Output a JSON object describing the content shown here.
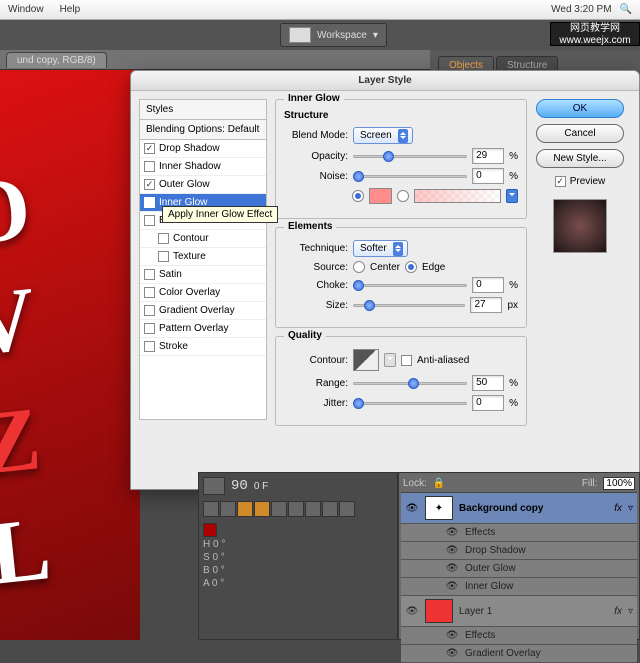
{
  "menubar": {
    "window": "Window",
    "help": "Help",
    "clock": "Wed 3:20 PM"
  },
  "watermark": {
    "line1": "网页教学网",
    "line2": "www.weejx.com"
  },
  "appbar": {
    "workspace_label": "Workspace",
    "caret": "▾"
  },
  "doc": {
    "tab": "und copy, RGB/8)"
  },
  "panel_tabs": {
    "objects": "Objects",
    "structure": "Structure"
  },
  "dialog": {
    "title": "Layer Style",
    "styles_header": "Styles",
    "blending": "Blending Options: Default",
    "items": [
      {
        "label": "Drop Shadow",
        "checked": true
      },
      {
        "label": "Inner Shadow",
        "checked": false
      },
      {
        "label": "Outer Glow",
        "checked": true
      },
      {
        "label": "Inner Glow",
        "checked": true,
        "selected": true
      },
      {
        "label": "Bevel and Emboss",
        "checked": false,
        "truncated": "Bev"
      },
      {
        "label": "Contour",
        "checked": false,
        "indent": true
      },
      {
        "label": "Texture",
        "checked": false,
        "indent": true
      },
      {
        "label": "Satin",
        "checked": false
      },
      {
        "label": "Color Overlay",
        "checked": false
      },
      {
        "label": "Gradient Overlay",
        "checked": false
      },
      {
        "label": "Pattern Overlay",
        "checked": false
      },
      {
        "label": "Stroke",
        "checked": false
      }
    ],
    "tooltip": "Apply Inner Glow Effect",
    "group_title": "Inner Glow",
    "structure": {
      "head": "Structure",
      "blend_mode_label": "Blend Mode:",
      "blend_mode_value": "Screen",
      "opacity_label": "Opacity:",
      "opacity_value": "29",
      "pct": "%",
      "noise_label": "Noise:",
      "noise_value": "0"
    },
    "elements": {
      "head": "Elements",
      "technique_label": "Technique:",
      "technique_value": "Softer",
      "source_label": "Source:",
      "center": "Center",
      "edge": "Edge",
      "choke_label": "Choke:",
      "choke_value": "0",
      "size_label": "Size:",
      "size_value": "27",
      "px": "px"
    },
    "quality": {
      "head": "Quality",
      "contour_label": "Contour:",
      "anti": "Anti-aliased",
      "range_label": "Range:",
      "range_value": "50",
      "jitter_label": "Jitter:",
      "jitter_value": "0"
    },
    "buttons": {
      "ok": "OK",
      "cancel": "Cancel",
      "new_style": "New Style...",
      "preview": "Preview"
    }
  },
  "timeline": {
    "num": "90",
    "frame": "0 F",
    "h": "H  0 °",
    "s": "S  0 °",
    "b": "B  0 °",
    "a": "A  0 °"
  },
  "layers": {
    "lock": "Lock:",
    "fill": "Fill:",
    "fill_val": "100%",
    "bgcopy": "Background copy",
    "effects": "Effects",
    "drop": "Drop Shadow",
    "outer": "Outer Glow",
    "inner": "Inner Glow",
    "layer1": "Layer 1",
    "grad": "Gradient Overlay",
    "fx": "fx",
    "eye": "👁",
    "tri": "▿",
    "tri2": "▾"
  }
}
